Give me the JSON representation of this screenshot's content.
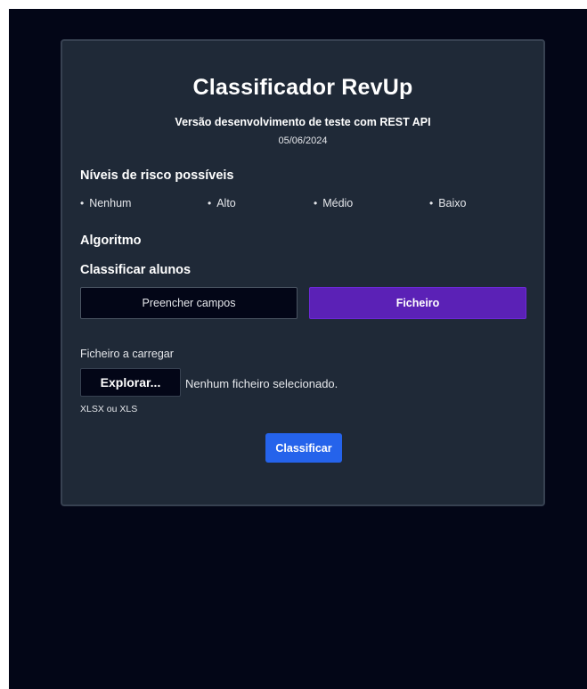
{
  "app": {
    "title": "Classificador RevUp",
    "subtitle": "Versão desenvolvimento de teste com REST API",
    "date": "05/06/2024"
  },
  "risk": {
    "heading": "Níveis de risco possíveis",
    "levels": [
      "Nenhum",
      "Alto",
      "Médio",
      "Baixo"
    ]
  },
  "algorithm": {
    "heading": "Algoritmo"
  },
  "classify": {
    "heading": "Classificar alunos",
    "tabs": [
      {
        "label": "Preencher campos",
        "active": false
      },
      {
        "label": "Ficheiro",
        "active": true
      }
    ]
  },
  "upload": {
    "label": "Ficheiro a carregar",
    "browse_label": "Explorar...",
    "status": "Nenhum ficheiro selecionado.",
    "hint": "XLSX ou XLS"
  },
  "submit": {
    "label": "Classificar"
  },
  "colors": {
    "background": "#030617",
    "card": "#1f2937",
    "active_tab": "#5b21b6",
    "primary_button": "#2563eb"
  }
}
